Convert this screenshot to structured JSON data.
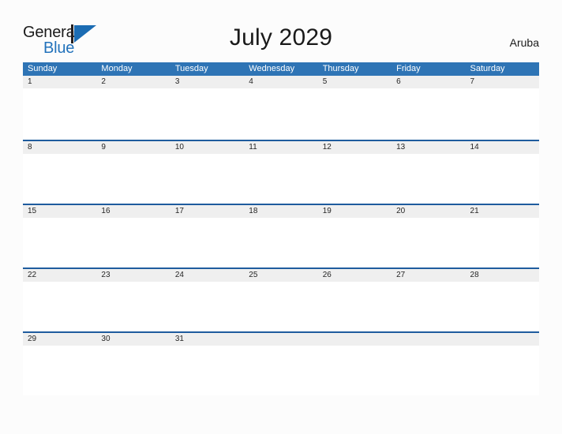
{
  "brand": {
    "name_part1": "General",
    "name_part2": "Blue",
    "logo_icon": "general-blue-triangle-logo",
    "accent_color": "#2272bb",
    "mark_color": "#1b6cb3"
  },
  "header": {
    "title": "July 2029",
    "location": "Aruba"
  },
  "colors": {
    "weekday_header_bg": "#2e74b5",
    "weekday_header_text": "#ffffff",
    "date_band_bg": "#efefef",
    "row_separator": "#1f5c9e",
    "page_bg": "#fcfcfc",
    "body_text": "#1a1a1a"
  },
  "calendar": {
    "month": "July",
    "year": "2029",
    "weekdays": [
      "Sunday",
      "Monday",
      "Tuesday",
      "Wednesday",
      "Thursday",
      "Friday",
      "Saturday"
    ],
    "weeks": [
      {
        "dates": [
          "1",
          "2",
          "3",
          "4",
          "5",
          "6",
          "7"
        ],
        "notes": [
          "",
          "",
          "",
          "",
          "",
          "",
          ""
        ]
      },
      {
        "dates": [
          "8",
          "9",
          "10",
          "11",
          "12",
          "13",
          "14"
        ],
        "notes": [
          "",
          "",
          "",
          "",
          "",
          "",
          ""
        ]
      },
      {
        "dates": [
          "15",
          "16",
          "17",
          "18",
          "19",
          "20",
          "21"
        ],
        "notes": [
          "",
          "",
          "",
          "",
          "",
          "",
          ""
        ]
      },
      {
        "dates": [
          "22",
          "23",
          "24",
          "25",
          "26",
          "27",
          "28"
        ],
        "notes": [
          "",
          "",
          "",
          "",
          "",
          "",
          ""
        ]
      },
      {
        "dates": [
          "29",
          "30",
          "31",
          "",
          "",
          "",
          ""
        ],
        "notes": [
          "",
          "",
          "",
          "",
          "",
          "",
          ""
        ]
      }
    ]
  }
}
